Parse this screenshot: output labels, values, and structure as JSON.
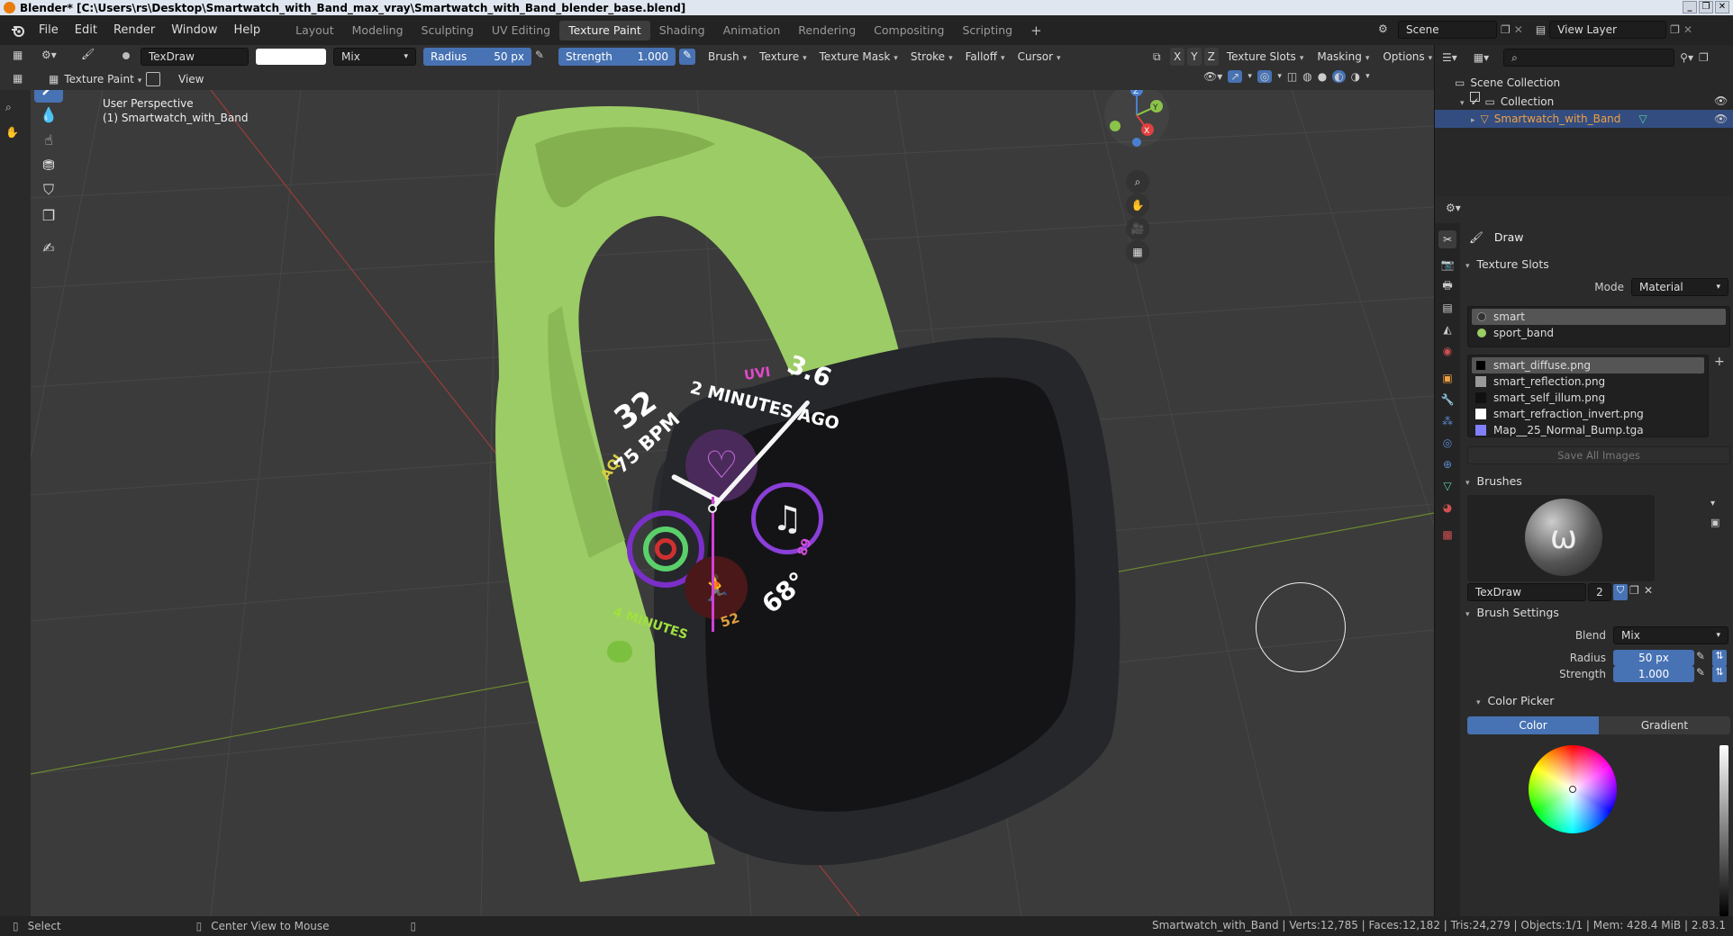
{
  "window": {
    "title": "Blender* [C:\\Users\\rs\\Desktop\\Smartwatch_with_Band_max_vray\\Smartwatch_with_Band_blender_base.blend]",
    "controls": [
      "_",
      "❐",
      "✕"
    ]
  },
  "menus": [
    "File",
    "Edit",
    "Render",
    "Window",
    "Help"
  ],
  "workspaces": [
    "Layout",
    "Modeling",
    "Sculpting",
    "UV Editing",
    "Texture Paint",
    "Shading",
    "Animation",
    "Rendering",
    "Compositing",
    "Scripting"
  ],
  "workspace_add": "+",
  "scene": {
    "name": "Scene",
    "view_layer": "View Layer"
  },
  "tool_header": {
    "brush_name": "TexDraw",
    "blend": "Mix",
    "radius_label": "Radius",
    "radius_value": "50 px",
    "strength_label": "Strength",
    "strength_value": "1.000",
    "menus": [
      "Brush",
      "Texture",
      "Texture Mask",
      "Stroke",
      "Falloff",
      "Cursor"
    ],
    "mirror": [
      "X",
      "Y",
      "Z"
    ],
    "right_menus": [
      "Texture Slots",
      "Masking",
      "Options"
    ]
  },
  "sub_header": {
    "mode": "Texture Paint",
    "view": "View"
  },
  "viewport": {
    "perspective": "User Perspective",
    "object": "(1) Smartwatch_with_Band",
    "watch_face": {
      "aqi": "AQI",
      "heart_num": "32",
      "bpm": "75 BPM",
      "minutes_ago": "2 MINUTES AGO",
      "uvi": "UVI",
      "uv_val": "3.6",
      "temp": "68°",
      "low": "52",
      "high": "89",
      "minutes": "4 MINUTES"
    },
    "colors": {
      "band": "#9ccc65",
      "case": "#25272b",
      "face": "#141416"
    }
  },
  "outliner": {
    "scene_collection": "Scene Collection",
    "collection": "Collection",
    "object": "Smartwatch_with_Band"
  },
  "properties": {
    "tool_name": "Draw",
    "texture_slots": {
      "title": "Texture Slots",
      "mode_label": "Mode",
      "mode_value": "Material",
      "materials": [
        "smart",
        "sport_band"
      ],
      "images": [
        "smart_diffuse.png",
        "smart_reflection.png",
        "smart_self_illum.png",
        "smart_refraction_invert.png",
        "Map__25_Normal_Bump.tga"
      ],
      "save_all": "Save All Images"
    },
    "brushes": {
      "title": "Brushes",
      "name": "TexDraw",
      "users": "2"
    },
    "brush_settings": {
      "title": "Brush Settings",
      "blend_label": "Blend",
      "blend_value": "Mix",
      "radius_label": "Radius",
      "radius_value": "50 px",
      "strength_label": "Strength",
      "strength_value": "1.000"
    },
    "color_picker": {
      "title": "Color Picker",
      "tab_color": "Color",
      "tab_gradient": "Gradient"
    }
  },
  "statusbar": {
    "select": "Select",
    "center_view": "Center View to Mouse",
    "stats": "Smartwatch_with_Band | Verts:12,785 | Faces:12,182 | Tris:24,279 | Objects:1/1 | Mem: 428.4 MiB | 2.83.1"
  }
}
